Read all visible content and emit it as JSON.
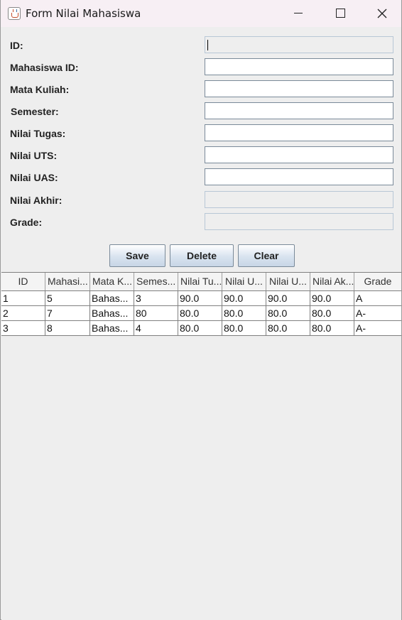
{
  "window": {
    "title": "Form Nilai Mahasiswa",
    "app_icon": "java-cup-icon"
  },
  "form": {
    "fields": [
      {
        "label": "ID:",
        "value": "",
        "enabled": false
      },
      {
        "label": "Mahasiswa ID:",
        "value": "",
        "enabled": true
      },
      {
        "label": "Mata Kuliah:",
        "value": "",
        "enabled": true
      },
      {
        "label": "Semester:",
        "value": "",
        "enabled": true
      },
      {
        "label": "Nilai Tugas:",
        "value": "",
        "enabled": true
      },
      {
        "label": "Nilai UTS:",
        "value": "",
        "enabled": true
      },
      {
        "label": "Nilai UAS:",
        "value": "",
        "enabled": true
      },
      {
        "label": "Nilai Akhir:",
        "value": "",
        "enabled": false
      },
      {
        "label": "Grade:",
        "value": "",
        "enabled": false
      }
    ]
  },
  "buttons": {
    "save": "Save",
    "delete": "Delete",
    "clear": "Clear"
  },
  "table": {
    "headers": [
      "ID",
      "Mahasi...",
      "Mata K...",
      "Semes...",
      "Nilai Tu...",
      "Nilai U...",
      "Nilai U...",
      "Nilai Ak...",
      "Grade"
    ],
    "rows": [
      [
        "1",
        "5",
        "Bahas...",
        "3",
        "90.0",
        "90.0",
        "90.0",
        "90.0",
        "A"
      ],
      [
        "2",
        "7",
        "Bahas...",
        "80",
        "80.0",
        "80.0",
        "80.0",
        "80.0",
        "A-"
      ],
      [
        "3",
        "8",
        "Bahas...",
        "4",
        "80.0",
        "80.0",
        "80.0",
        "80.0",
        "A-"
      ]
    ]
  }
}
